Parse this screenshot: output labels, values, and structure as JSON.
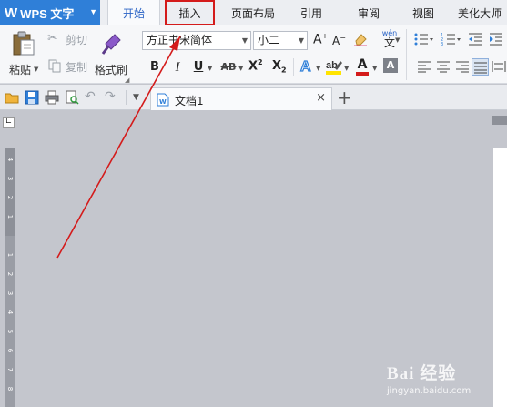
{
  "app": {
    "name": "WPS 文字",
    "logo_glyph": "W",
    "accent": "#2f7fd8"
  },
  "ribbon_tabs": [
    {
      "label": "开始",
      "active": true
    },
    {
      "label": "插入",
      "highlighted": true
    },
    {
      "label": "页面布局"
    },
    {
      "label": "引用"
    },
    {
      "label": "审阅"
    },
    {
      "label": "视图"
    },
    {
      "label": "美化大师"
    }
  ],
  "clipboard": {
    "paste": "粘贴",
    "cut": "剪切",
    "copy": "复制",
    "format_painter": "格式刷"
  },
  "font": {
    "family": "方正书宋简体",
    "size": "小二"
  },
  "format_buttons": {
    "bold": "B",
    "italic": "I",
    "underline": "U",
    "strike": "AB",
    "superscript": "X",
    "sup_mark": "2",
    "subscript": "X",
    "sub_mark": "2",
    "font_color": "A",
    "grow": "A",
    "shrink": "A",
    "char_shading": "A",
    "phonetic_top": "wén",
    "phonetic_bottom": "文"
  },
  "document_tab": {
    "name": "文档1",
    "close": "×"
  },
  "new_tab": "+",
  "ruler_ticks": [
    "4",
    "3",
    "2",
    "1",
    "1",
    "2",
    "3",
    "4",
    "5",
    "6",
    "7",
    "8"
  ],
  "watermark": {
    "line1": "Bai 经验",
    "line2": "jingyan.baidu.com"
  },
  "colors": {
    "highlight_box": "#d41b1b",
    "arrow": "#d41b1b",
    "font_color_bar": "#d41b1b",
    "highlight_bar": "#ffe400"
  }
}
